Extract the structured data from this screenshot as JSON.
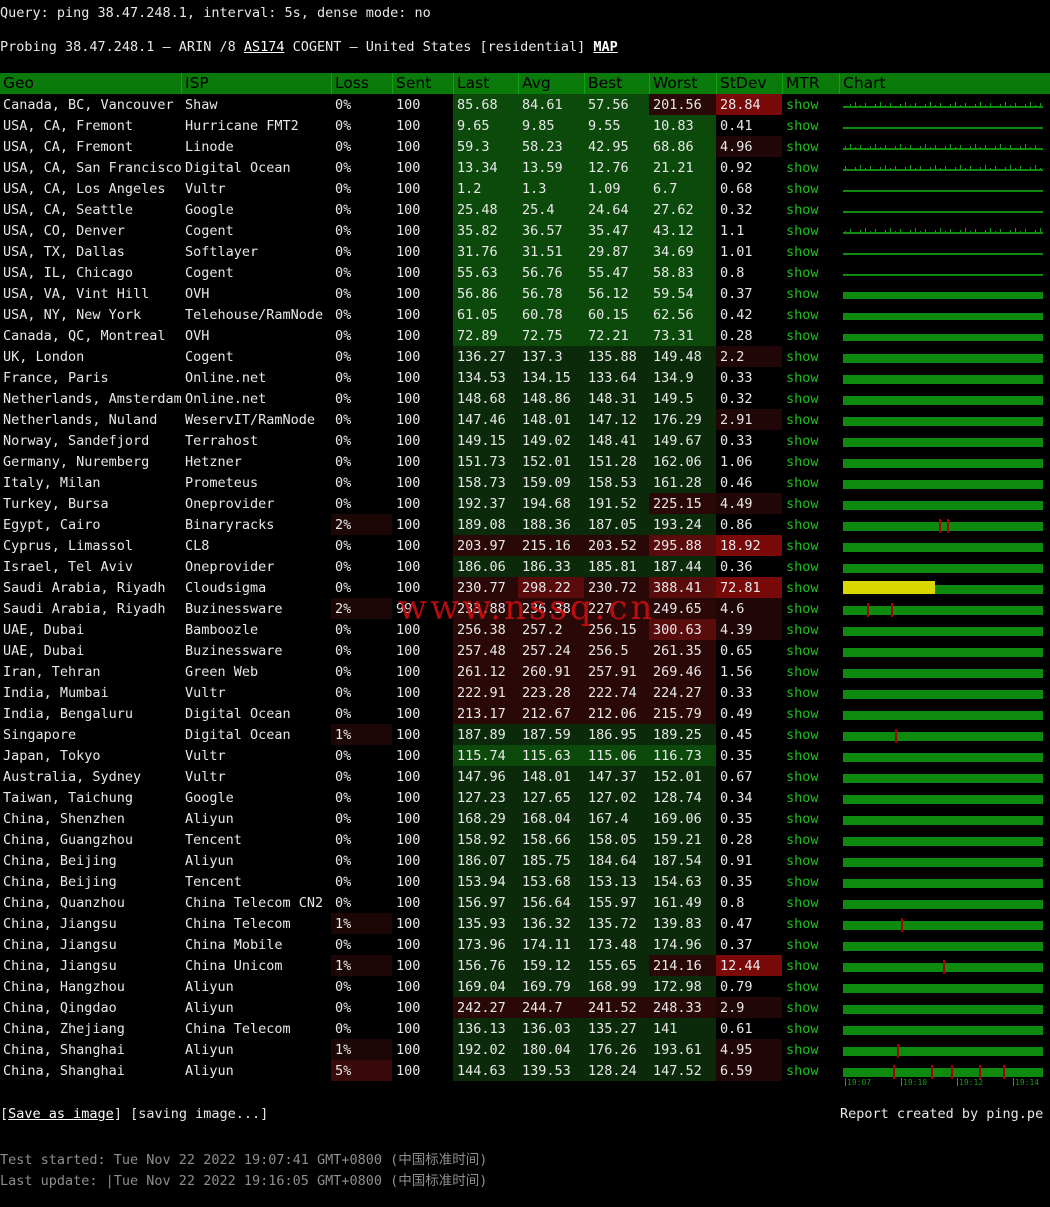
{
  "query_line": "Query: ping 38.47.248.1, interval: 5s, dense mode: no",
  "probe": {
    "prefix": "Probing 38.47.248.1 — ARIN /8 ",
    "as_link": "AS174",
    "middle": " COGENT — United States [residential] ",
    "map_link": "MAP"
  },
  "headers": [
    "Geo",
    "ISP",
    "Loss",
    "Sent",
    "Last",
    "Avg",
    "Best",
    "Worst",
    "StDev",
    "MTR",
    "Chart"
  ],
  "mtr_label": "show",
  "rows": [
    {
      "geo": "Canada, BC, Vancouver",
      "isp": "Shaw",
      "loss": "0%",
      "sent": "100",
      "last": "85.68",
      "avg": "84.61",
      "best": "57.56",
      "worst": "201.56",
      "stdev": "28.84",
      "chart": "spiky"
    },
    {
      "geo": "USA, CA, Fremont",
      "isp": "Hurricane FMT2",
      "loss": "0%",
      "sent": "100",
      "last": "9.65",
      "avg": "9.85",
      "best": "9.55",
      "worst": "10.83",
      "stdev": "0.41",
      "chart": "thin"
    },
    {
      "geo": "USA, CA, Fremont",
      "isp": "Linode",
      "loss": "0%",
      "sent": "100",
      "last": "59.3",
      "avg": "58.23",
      "best": "42.95",
      "worst": "68.86",
      "stdev": "4.96",
      "chart": "spiky"
    },
    {
      "geo": "USA, CA, San Francisco",
      "isp": "Digital Ocean",
      "loss": "0%",
      "sent": "100",
      "last": "13.34",
      "avg": "13.59",
      "best": "12.76",
      "worst": "21.21",
      "stdev": "0.92",
      "chart": "spiky"
    },
    {
      "geo": "USA, CA, Los Angeles",
      "isp": "Vultr",
      "loss": "0%",
      "sent": "100",
      "last": "1.2",
      "avg": "1.3",
      "best": "1.09",
      "worst": "6.7",
      "stdev": "0.68",
      "chart": "thin"
    },
    {
      "geo": "USA, CA, Seattle",
      "isp": "Google",
      "loss": "0%",
      "sent": "100",
      "last": "25.48",
      "avg": "25.4",
      "best": "24.64",
      "worst": "27.62",
      "stdev": "0.32",
      "chart": "thin"
    },
    {
      "geo": "USA, CO, Denver",
      "isp": "Cogent",
      "loss": "0%",
      "sent": "100",
      "last": "35.82",
      "avg": "36.57",
      "best": "35.47",
      "worst": "43.12",
      "stdev": "1.1",
      "chart": "spiky"
    },
    {
      "geo": "USA, TX, Dallas",
      "isp": "Softlayer",
      "loss": "0%",
      "sent": "100",
      "last": "31.76",
      "avg": "31.51",
      "best": "29.87",
      "worst": "34.69",
      "stdev": "1.01",
      "chart": "thin"
    },
    {
      "geo": "USA, IL, Chicago",
      "isp": "Cogent",
      "loss": "0%",
      "sent": "100",
      "last": "55.63",
      "avg": "56.76",
      "best": "55.47",
      "worst": "58.83",
      "stdev": "0.8",
      "chart": "thin"
    },
    {
      "geo": "USA, VA, Vint Hill",
      "isp": "OVH",
      "loss": "0%",
      "sent": "100",
      "last": "56.86",
      "avg": "56.78",
      "best": "56.12",
      "worst": "59.54",
      "stdev": "0.37",
      "chart": "mid"
    },
    {
      "geo": "USA, NY, New York",
      "isp": "Telehouse/RamNode",
      "loss": "0%",
      "sent": "100",
      "last": "61.05",
      "avg": "60.78",
      "best": "60.15",
      "worst": "62.56",
      "stdev": "0.42",
      "chart": "mid"
    },
    {
      "geo": "Canada, QC, Montreal",
      "isp": "OVH",
      "loss": "0%",
      "sent": "100",
      "last": "72.89",
      "avg": "72.75",
      "best": "72.21",
      "worst": "73.31",
      "stdev": "0.28",
      "chart": "mid"
    },
    {
      "geo": "UK, London",
      "isp": "Cogent",
      "loss": "0%",
      "sent": "100",
      "last": "136.27",
      "avg": "137.3",
      "best": "135.88",
      "worst": "149.48",
      "stdev": "2.2",
      "chart": "full"
    },
    {
      "geo": "France, Paris",
      "isp": "Online.net",
      "loss": "0%",
      "sent": "100",
      "last": "134.53",
      "avg": "134.15",
      "best": "133.64",
      "worst": "134.9",
      "stdev": "0.33",
      "chart": "full"
    },
    {
      "geo": "Netherlands, Amsterdam",
      "isp": "Online.net",
      "loss": "0%",
      "sent": "100",
      "last": "148.68",
      "avg": "148.86",
      "best": "148.31",
      "worst": "149.5",
      "stdev": "0.32",
      "chart": "full"
    },
    {
      "geo": "Netherlands, Nuland",
      "isp": "WeservIT/RamNode",
      "loss": "0%",
      "sent": "100",
      "last": "147.46",
      "avg": "148.01",
      "best": "147.12",
      "worst": "176.29",
      "stdev": "2.91",
      "chart": "full"
    },
    {
      "geo": "Norway, Sandefjord",
      "isp": "Terrahost",
      "loss": "0%",
      "sent": "100",
      "last": "149.15",
      "avg": "149.02",
      "best": "148.41",
      "worst": "149.67",
      "stdev": "0.33",
      "chart": "full"
    },
    {
      "geo": "Germany, Nuremberg",
      "isp": "Hetzner",
      "loss": "0%",
      "sent": "100",
      "last": "151.73",
      "avg": "152.01",
      "best": "151.28",
      "worst": "162.06",
      "stdev": "1.06",
      "chart": "full"
    },
    {
      "geo": "Italy, Milan",
      "isp": "Prometeus",
      "loss": "0%",
      "sent": "100",
      "last": "158.73",
      "avg": "159.09",
      "best": "158.53",
      "worst": "161.28",
      "stdev": "0.46",
      "chart": "full"
    },
    {
      "geo": "Turkey, Bursa",
      "isp": "Oneprovider",
      "loss": "0%",
      "sent": "100",
      "last": "192.37",
      "avg": "194.68",
      "best": "191.52",
      "worst": "225.15",
      "stdev": "4.49",
      "chart": "full"
    },
    {
      "geo": "Egypt, Cairo",
      "isp": "Binaryracks",
      "loss": "2%",
      "sent": "100",
      "last": "189.08",
      "avg": "188.36",
      "best": "187.05",
      "worst": "193.24",
      "stdev": "0.86",
      "chart": "full",
      "ticks": [
        48,
        52
      ]
    },
    {
      "geo": "Cyprus, Limassol",
      "isp": "CL8",
      "loss": "0%",
      "sent": "100",
      "last": "203.97",
      "avg": "215.16",
      "best": "203.52",
      "worst": "295.88",
      "stdev": "18.92",
      "chart": "full"
    },
    {
      "geo": "Israel, Tel Aviv",
      "isp": "Oneprovider",
      "loss": "0%",
      "sent": "100",
      "last": "186.06",
      "avg": "186.33",
      "best": "185.81",
      "worst": "187.44",
      "stdev": "0.36",
      "chart": "full"
    },
    {
      "geo": "Saudi Arabia, Riyadh",
      "isp": "Cloudsigma",
      "loss": "0%",
      "sent": "100",
      "last": "230.77",
      "avg": "298.22",
      "best": "230.72",
      "worst": "388.41",
      "stdev": "72.81",
      "chart": "yellow"
    },
    {
      "geo": "Saudi Arabia, Riyadh",
      "isp": "Buzinessware",
      "loss": "2%",
      "sent": "99",
      "last": "233.88",
      "avg": "236.38",
      "best": "227",
      "worst": "249.65",
      "stdev": "4.6",
      "chart": "full",
      "ticks": [
        12,
        24
      ]
    },
    {
      "geo": "UAE, Dubai",
      "isp": "Bamboozle",
      "loss": "0%",
      "sent": "100",
      "last": "256.38",
      "avg": "257.2",
      "best": "256.15",
      "worst": "300.63",
      "stdev": "4.39",
      "chart": "full"
    },
    {
      "geo": "UAE, Dubai",
      "isp": "Buzinessware",
      "loss": "0%",
      "sent": "100",
      "last": "257.48",
      "avg": "257.24",
      "best": "256.5",
      "worst": "261.35",
      "stdev": "0.65",
      "chart": "full"
    },
    {
      "geo": "Iran, Tehran",
      "isp": "Green Web",
      "loss": "0%",
      "sent": "100",
      "last": "261.12",
      "avg": "260.91",
      "best": "257.91",
      "worst": "269.46",
      "stdev": "1.56",
      "chart": "full"
    },
    {
      "geo": "India, Mumbai",
      "isp": "Vultr",
      "loss": "0%",
      "sent": "100",
      "last": "222.91",
      "avg": "223.28",
      "best": "222.74",
      "worst": "224.27",
      "stdev": "0.33",
      "chart": "full"
    },
    {
      "geo": "India, Bengaluru",
      "isp": "Digital Ocean",
      "loss": "0%",
      "sent": "100",
      "last": "213.17",
      "avg": "212.67",
      "best": "212.06",
      "worst": "215.79",
      "stdev": "0.49",
      "chart": "full"
    },
    {
      "geo": "Singapore",
      "isp": "Digital Ocean",
      "loss": "1%",
      "sent": "100",
      "last": "187.89",
      "avg": "187.59",
      "best": "186.95",
      "worst": "189.25",
      "stdev": "0.45",
      "chart": "full",
      "ticks": [
        26
      ]
    },
    {
      "geo": "Japan, Tokyo",
      "isp": "Vultr",
      "loss": "0%",
      "sent": "100",
      "last": "115.74",
      "avg": "115.63",
      "best": "115.06",
      "worst": "116.73",
      "stdev": "0.35",
      "chart": "full"
    },
    {
      "geo": "Australia, Sydney",
      "isp": "Vultr",
      "loss": "0%",
      "sent": "100",
      "last": "147.96",
      "avg": "148.01",
      "best": "147.37",
      "worst": "152.01",
      "stdev": "0.67",
      "chart": "full"
    },
    {
      "geo": "Taiwan, Taichung",
      "isp": "Google",
      "loss": "0%",
      "sent": "100",
      "last": "127.23",
      "avg": "127.65",
      "best": "127.02",
      "worst": "128.74",
      "stdev": "0.34",
      "chart": "full"
    },
    {
      "geo": "China, Shenzhen",
      "isp": "Aliyun",
      "loss": "0%",
      "sent": "100",
      "last": "168.29",
      "avg": "168.04",
      "best": "167.4",
      "worst": "169.06",
      "stdev": "0.35",
      "chart": "full"
    },
    {
      "geo": "China, Guangzhou",
      "isp": "Tencent",
      "loss": "0%",
      "sent": "100",
      "last": "158.92",
      "avg": "158.66",
      "best": "158.05",
      "worst": "159.21",
      "stdev": "0.28",
      "chart": "full"
    },
    {
      "geo": "China, Beijing",
      "isp": "Aliyun",
      "loss": "0%",
      "sent": "100",
      "last": "186.07",
      "avg": "185.75",
      "best": "184.64",
      "worst": "187.54",
      "stdev": "0.91",
      "chart": "full"
    },
    {
      "geo": "China, Beijing",
      "isp": "Tencent",
      "loss": "0%",
      "sent": "100",
      "last": "153.94",
      "avg": "153.68",
      "best": "153.13",
      "worst": "154.63",
      "stdev": "0.35",
      "chart": "full"
    },
    {
      "geo": "China, Quanzhou",
      "isp": "China Telecom CN2",
      "loss": "0%",
      "sent": "100",
      "last": "156.97",
      "avg": "156.64",
      "best": "155.97",
      "worst": "161.49",
      "stdev": "0.8",
      "chart": "full"
    },
    {
      "geo": "China, Jiangsu",
      "isp": "China Telecom",
      "loss": "1%",
      "sent": "100",
      "last": "135.93",
      "avg": "136.32",
      "best": "135.72",
      "worst": "139.83",
      "stdev": "0.47",
      "chart": "full",
      "ticks": [
        29
      ]
    },
    {
      "geo": "China, Jiangsu",
      "isp": "China Mobile",
      "loss": "0%",
      "sent": "100",
      "last": "173.96",
      "avg": "174.11",
      "best": "173.48",
      "worst": "174.96",
      "stdev": "0.37",
      "chart": "full"
    },
    {
      "geo": "China, Jiangsu",
      "isp": "China Unicom",
      "loss": "1%",
      "sent": "100",
      "last": "156.76",
      "avg": "159.12",
      "best": "155.65",
      "worst": "214.16",
      "stdev": "12.44",
      "chart": "full",
      "ticks": [
        50
      ]
    },
    {
      "geo": "China, Hangzhou",
      "isp": "Aliyun",
      "loss": "0%",
      "sent": "100",
      "last": "169.04",
      "avg": "169.79",
      "best": "168.99",
      "worst": "172.98",
      "stdev": "0.79",
      "chart": "full"
    },
    {
      "geo": "China, Qingdao",
      "isp": "Aliyun",
      "loss": "0%",
      "sent": "100",
      "last": "242.27",
      "avg": "244.7",
      "best": "241.52",
      "worst": "248.33",
      "stdev": "2.9",
      "chart": "full"
    },
    {
      "geo": "China, Zhejiang",
      "isp": "China Telecom",
      "loss": "0%",
      "sent": "100",
      "last": "136.13",
      "avg": "136.03",
      "best": "135.27",
      "worst": "141",
      "stdev": "0.61",
      "chart": "full"
    },
    {
      "geo": "China, Shanghai",
      "isp": "Aliyun",
      "loss": "1%",
      "sent": "100",
      "last": "192.02",
      "avg": "180.04",
      "best": "176.26",
      "worst": "193.61",
      "stdev": "4.95",
      "chart": "full",
      "ticks": [
        27
      ]
    },
    {
      "geo": "China, Shanghai",
      "isp": "Aliyun",
      "loss": "5%",
      "sent": "100",
      "last": "144.63",
      "avg": "139.53",
      "best": "128.24",
      "worst": "147.52",
      "stdev": "6.59",
      "chart": "full",
      "ticks": [
        25,
        44,
        54,
        68,
        80
      ]
    }
  ],
  "chart_axis": [
    "19:07",
    "19:10",
    "19:12",
    "19:14"
  ],
  "save_link": "Save as image",
  "saving_text": "[saving image...]",
  "report_credit": "Report created by ping.pe",
  "test_started": "Test started: Tue Nov 22 2022 19:07:41 GMT+0800 (中国标准时间)",
  "last_update": "Last update: |Tue Nov 22 2022 19:16:05 GMT+0800 (中国标准时间)",
  "watermark": "www.nssq.cn",
  "colors": {
    "header": "#0a7a0a",
    "ok": "#1ec01e",
    "warn": "#6a1010",
    "bad": "#8a0a0a",
    "yellow": "#d8d800"
  }
}
